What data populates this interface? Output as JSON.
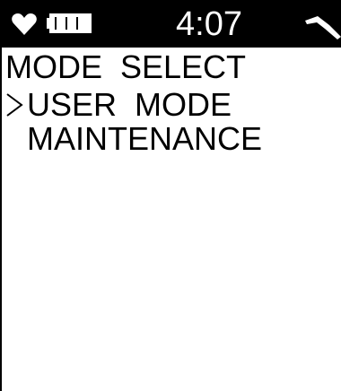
{
  "status_bar": {
    "time": "4:07",
    "icons": [
      "heart-icon",
      "battery-icon",
      "signal-icon"
    ],
    "background": "#000000",
    "foreground": "#ffffff"
  },
  "screen": {
    "title": "MODE  SELECT",
    "selected_index": 0,
    "menu_items": [
      {
        "label": "USER  MODE"
      },
      {
        "label": "MAINTENANCE"
      }
    ]
  }
}
